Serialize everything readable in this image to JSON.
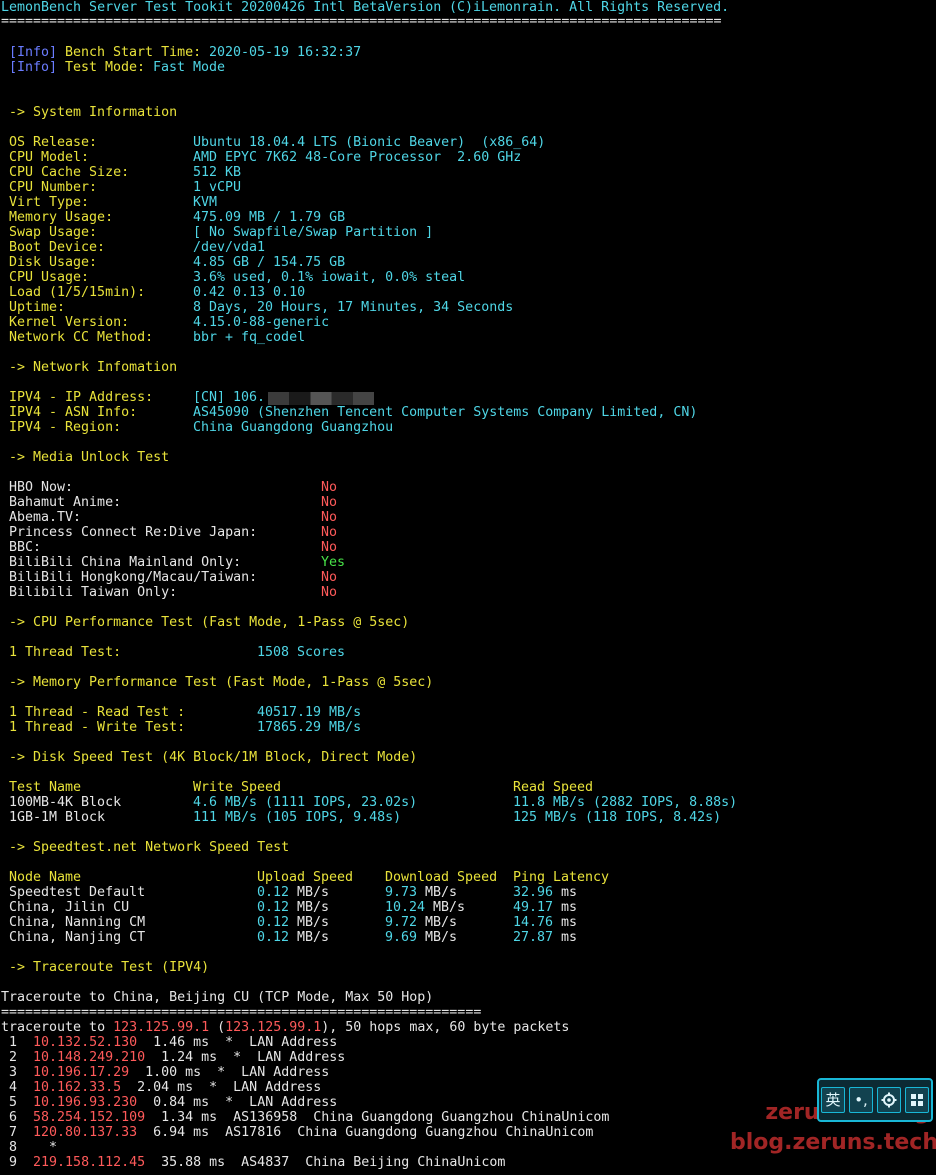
{
  "header": {
    "title": "LemonBench Server Test Tookit 20200426 Intl BetaVersion",
    "copyright": "(C)iLemonrain. All Rights Reserved.",
    "separator": "=========================================================================================="
  },
  "bench_info": [
    {
      "tag": "[Info]",
      "label": "Bench Start Time:",
      "value": "2020-05-19 16:32:37"
    },
    {
      "tag": "[Info]",
      "label": "Test Mode:",
      "value": "Fast Mode"
    }
  ],
  "sections": {
    "system": "-> System Information",
    "network": "-> Network Infomation",
    "media": "-> Media Unlock Test",
    "cpu": "-> CPU Performance Test (Fast Mode, 1-Pass @ 5sec)",
    "memory": "-> Memory Performance Test (Fast Mode, 1-Pass @ 5sec)",
    "disk": "-> Disk Speed Test (4K Block/1M Block, Direct Mode)",
    "speedtest": "-> Speedtest.net Network Speed Test",
    "traceroute": "-> Traceroute Test (IPV4)"
  },
  "system_info": [
    {
      "label": "OS Release:",
      "value": "Ubuntu 18.04.4 LTS (Bionic Beaver)  (x86_64)"
    },
    {
      "label": "CPU Model:",
      "value": "AMD EPYC 7K62 48-Core Processor  2.60 GHz"
    },
    {
      "label": "CPU Cache Size:",
      "value": "512 KB"
    },
    {
      "label": "CPU Number:",
      "value": "1 vCPU"
    },
    {
      "label": "Virt Type:",
      "value": "KVM"
    },
    {
      "label": "Memory Usage:",
      "value": "475.09 MB / 1.79 GB"
    },
    {
      "label": "Swap Usage:",
      "value": "[ No Swapfile/Swap Partition ]"
    },
    {
      "label": "Boot Device:",
      "value": "/dev/vda1"
    },
    {
      "label": "Disk Usage:",
      "value": "4.85 GB / 154.75 GB"
    },
    {
      "label": "CPU Usage:",
      "value": "3.6% used, 0.1% iowait, 0.0% steal"
    },
    {
      "label": "Load (1/5/15min):",
      "value": "0.42 0.13 0.10"
    },
    {
      "label": "Uptime:",
      "value": "8 Days, 20 Hours, 17 Minutes, 34 Seconds"
    },
    {
      "label": "Kernel Version:",
      "value": "4.15.0-88-generic"
    },
    {
      "label": "Network CC Method:",
      "value": "bbr + fq_codel"
    }
  ],
  "network_info": [
    {
      "label": "IPV4 - IP Address:",
      "value": "[CN] 106."
    },
    {
      "label": "IPV4 - ASN Info:",
      "value": "AS45090 (Shenzhen Tencent Computer Systems Company Limited, CN)"
    },
    {
      "label": "IPV4 - Region:",
      "value": "China Guangdong Guangzhou"
    }
  ],
  "media_unlock": [
    {
      "label": "HBO Now:",
      "value": "No",
      "status": "no"
    },
    {
      "label": "Bahamut Anime:",
      "value": "No",
      "status": "no"
    },
    {
      "label": "Abema.TV:",
      "value": "No",
      "status": "no"
    },
    {
      "label": "Princess Connect Re:Dive Japan:",
      "value": "No",
      "status": "no"
    },
    {
      "label": "BBC:",
      "value": "No",
      "status": "no"
    },
    {
      "label": "BiliBili China Mainland Only:",
      "value": "Yes",
      "status": "yes"
    },
    {
      "label": "BiliBili Hongkong/Macau/Taiwan:",
      "value": "No",
      "status": "no"
    },
    {
      "label": "Bilibili Taiwan Only:",
      "value": "No",
      "status": "no"
    }
  ],
  "cpu_test": {
    "label": "1 Thread Test:",
    "value": "1508 Scores"
  },
  "memory_test": [
    {
      "label": "1 Thread - Read Test :",
      "value": "40517.19 MB/s"
    },
    {
      "label": "1 Thread - Write Test:",
      "value": "17865.29 MB/s"
    }
  ],
  "disk_test": {
    "headers": [
      "Test Name",
      "Write Speed",
      "Read Speed"
    ],
    "rows": [
      {
        "name": "100MB-4K Block",
        "write": "4.6 MB/s (1111 IOPS, 23.02s)",
        "read": "11.8 MB/s (2882 IOPS, 8.88s)"
      },
      {
        "name": "1GB-1M Block",
        "write": "111 MB/s (105 IOPS, 9.48s)",
        "read": "125 MB/s (118 IOPS, 8.42s)"
      }
    ]
  },
  "speedtest": {
    "headers": [
      "Node Name",
      "Upload Speed",
      "Download Speed",
      "Ping Latency"
    ],
    "rows": [
      {
        "node": "Speedtest Default",
        "up": "0.12",
        "down": "9.73",
        "ping": "32.96"
      },
      {
        "node": "China, Jilin CU",
        "up": "0.12",
        "down": "10.24",
        "ping": "49.17"
      },
      {
        "node": "China, Nanning CM",
        "up": "0.12",
        "down": "9.72",
        "ping": "14.76"
      },
      {
        "node": "China, Nanjing CT",
        "up": "0.12",
        "down": "9.69",
        "ping": "27.87"
      }
    ],
    "speed_unit": "MB/s",
    "ping_unit": "ms"
  },
  "traceroute": {
    "title": "Traceroute to China, Beijing CU (TCP Mode, Max 50 Hop)",
    "separator": "============================================================",
    "cmd_prefix": "traceroute to ",
    "target_ip": "123.125.99.1",
    "target_ip_paren": "123.125.99.1",
    "cmd_suffix": ", 50 hops max, 60 byte packets",
    "hops": [
      {
        "n": " 1",
        "ip": "10.132.52.130",
        "rest": "  1.46 ms  *  LAN Address"
      },
      {
        "n": " 2",
        "ip": "10.148.249.210",
        "rest": "  1.24 ms  *  LAN Address"
      },
      {
        "n": " 3",
        "ip": "10.196.17.29",
        "rest": "  1.00 ms  *  LAN Address"
      },
      {
        "n": " 4",
        "ip": "10.162.33.5",
        "rest": "  2.04 ms  *  LAN Address"
      },
      {
        "n": " 5",
        "ip": "10.196.93.230",
        "rest": "  0.84 ms  *  LAN Address"
      },
      {
        "n": " 6",
        "ip": "58.254.152.109",
        "rest": "  1.34 ms  AS136958  China Guangdong Guangzhou ChinaUnicom"
      },
      {
        "n": " 7",
        "ip": "120.80.137.33",
        "rest": "  6.94 ms  AS17816  China Guangdong Guangzhou ChinaUnicom"
      },
      {
        "n": " 8",
        "ip": "",
        "rest": "  *"
      },
      {
        "n": " 9",
        "ip": "219.158.112.45",
        "rest": "  35.88 ms  AS4837  China Beijing ChinaUnicom"
      }
    ]
  },
  "watermark": {
    "line1": "zeruns's blog",
    "line2": "blog.zeruns.tech"
  },
  "ime_toolbar": {
    "lang": "英",
    "punct": "•,",
    "settings_icon": "gear-icon",
    "skin_icon": "grid-icon"
  },
  "colors": {
    "background": "#000000",
    "text": "#e6e6e6",
    "cyan": "#4fd6e6",
    "yellow": "#e8e23a",
    "red": "#ff5a5a",
    "green": "#48e048",
    "info_blue": "#6a7cff"
  }
}
